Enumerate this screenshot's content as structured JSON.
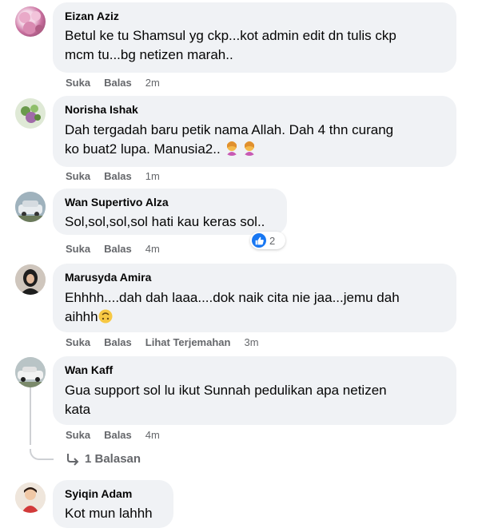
{
  "actions": {
    "like": "Suka",
    "reply": "Balas",
    "translate": "Lihat Terjemahan"
  },
  "comments": [
    {
      "author": "Eizan Aziz",
      "text": "Betul ke tu Shamsul yg ckp...kot admin edit dn tulis ckp\nmcm tu...bg netizen marah..",
      "time": "2m"
    },
    {
      "author": "Norisha Ishak",
      "text": "Dah tergadah baru petik nama Allah. Dah 4 thn curang\nko buat2 lupa. Manusia2.. ",
      "emoji": [
        "woman-shrugging-emoji",
        "woman-shrugging-emoji"
      ],
      "time": "1m"
    },
    {
      "author": "Wan Supertivo Alza",
      "text": "Sol,sol,sol,sol hati kau keras sol..",
      "time": "4m",
      "reaction": {
        "icon": "like-icon",
        "count": "2"
      }
    },
    {
      "author": "Marusyda Amira",
      "text": "Ehhhh....dah dah laaa....dok naik cita nie jaa...jemu dah\naihhh",
      "emoji": [
        "upside-down-face-emoji"
      ],
      "time": "3m"
    },
    {
      "author": "Wan Kaff",
      "text": "Gua support sol lu ikut Sunnah pedulikan apa netizen\nkata",
      "time": "4m"
    },
    {
      "author": "Syiqin Adam",
      "text": "Kot mun lahhh"
    }
  ],
  "replies": {
    "label": "1 Balasan",
    "icon": "reply-arrow-icon"
  },
  "colors": {
    "bubble": "#f0f2f5",
    "muted": "#65676b",
    "like_blue": "#1877f2"
  }
}
